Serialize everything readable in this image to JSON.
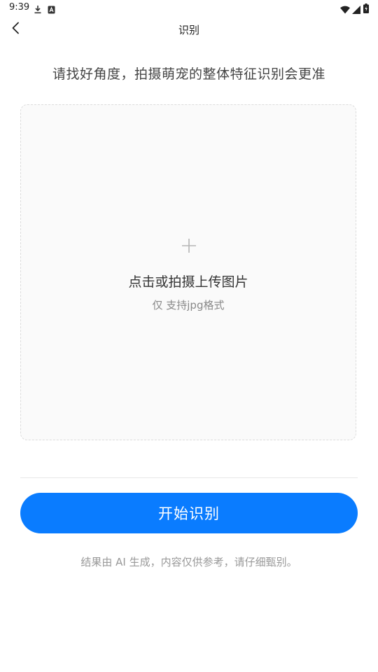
{
  "status_bar": {
    "time": "9:39",
    "icons": [
      "download-icon",
      "accessibility-icon",
      "wifi-icon",
      "signal-icon",
      "battery-icon"
    ]
  },
  "app_bar": {
    "title": "识别",
    "back_icon": "chevron-left-icon"
  },
  "hint": "请找好角度，拍摄萌宠的整体特征识别会更准",
  "upload": {
    "icon": "plus-icon",
    "label": "点击或拍摄上传图片",
    "sublabel": "仅 支持jpg格式"
  },
  "action": {
    "start_label": "开始识别"
  },
  "disclaimer": "结果由 AI 生成，内容仅供参考，请仔细甄别。",
  "colors": {
    "accent": "#0a7cff",
    "upload_bg": "#fafafa",
    "upload_border": "#dcdcdc"
  }
}
